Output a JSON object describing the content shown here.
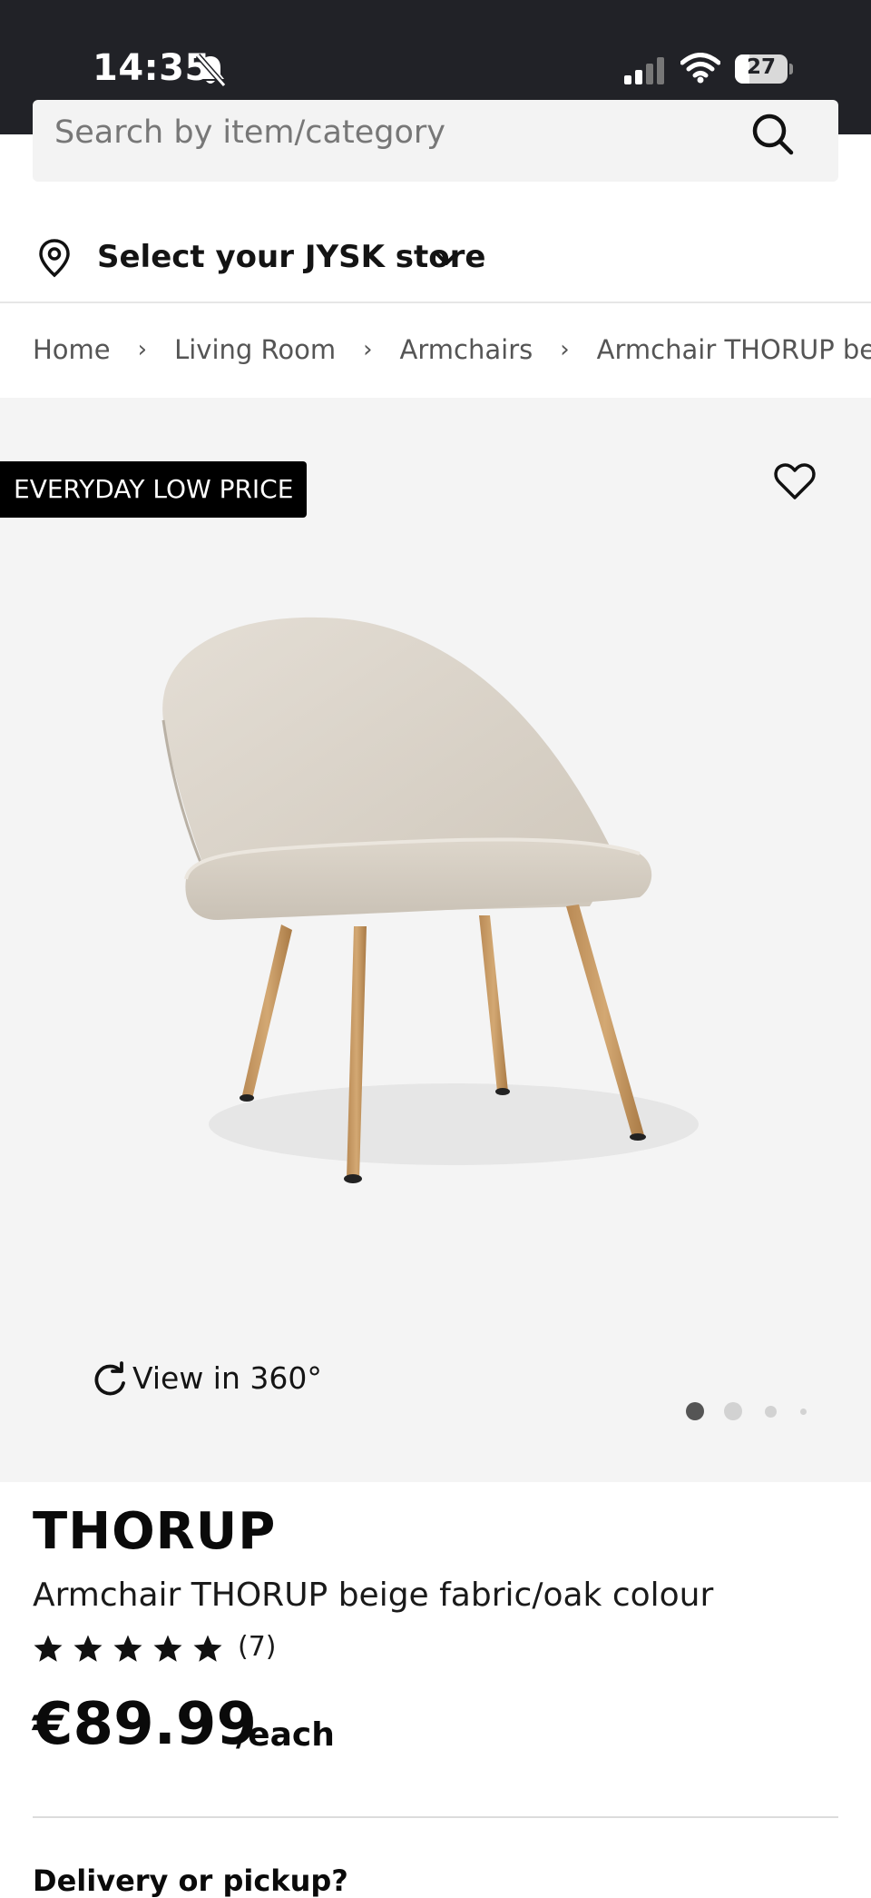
{
  "status_bar": {
    "time": "14:35",
    "battery_level": "27",
    "battery_fraction": 0.27,
    "icons": [
      "bell-slash-icon",
      "signal-icon",
      "wifi-icon",
      "battery-icon"
    ]
  },
  "search": {
    "placeholder": "Search by item/category",
    "icon": "search-icon"
  },
  "store": {
    "label": "Select your JYSK store",
    "icons": [
      "location-pin-icon",
      "chevron-down-icon"
    ]
  },
  "breadcrumb": {
    "items": [
      "Home",
      "Living Room",
      "Armchairs",
      "Armchair THORUP beige fa"
    ]
  },
  "gallery": {
    "badge": "EVERYDAY LOW PRICE",
    "view360_label": "View in 360°",
    "active_image_index": 0,
    "image_count": 4,
    "icons": [
      "heart-icon",
      "rotate-icon"
    ]
  },
  "product": {
    "brand": "THORUP",
    "name": "Armchair THORUP beige fabric/oak colour",
    "rating": 5,
    "rating_max": 5,
    "review_count": "(7)",
    "price": "€89.99",
    "unit": "/each"
  },
  "delivery": {
    "heading": "Delivery or pickup?"
  },
  "colors": {
    "status_bar_bg": "#212227",
    "gallery_bg": "#f4f4f4",
    "badge_bg": "#000000",
    "text": "#141414"
  }
}
